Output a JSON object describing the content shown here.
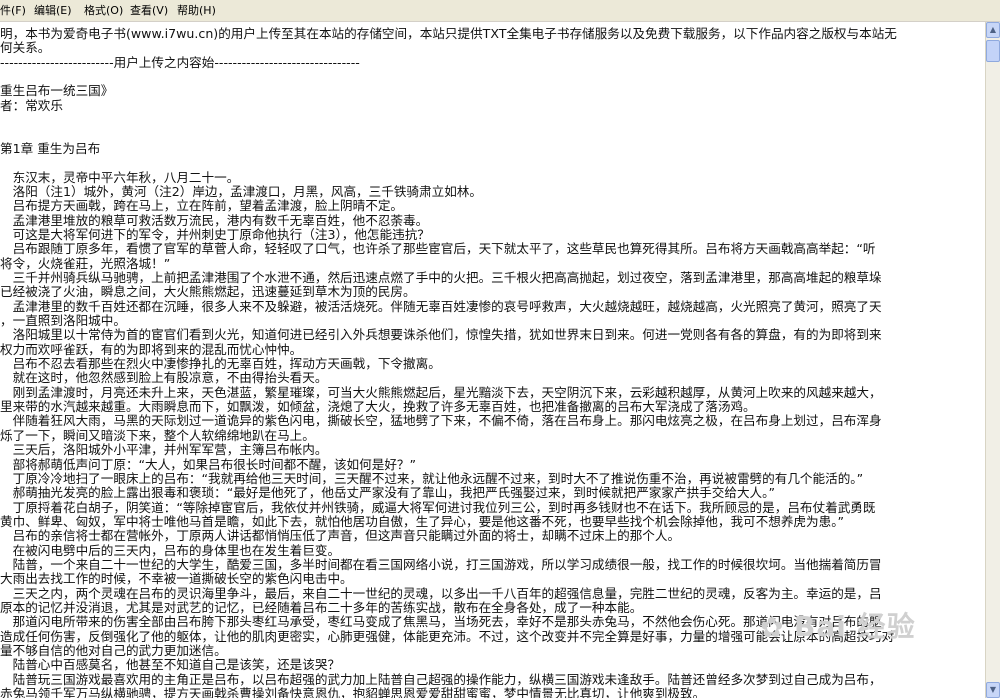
{
  "menu": [
    "件(F)",
    "编辑(E)",
    "格式(O)",
    "查看(V)",
    "帮助(H)"
  ],
  "lines": [
    "明，本书为爱奇电子书(www.i7wu.cn)的用户上传至其在本站的存储空间，本站只提供TXT全集电子书存储服务以及免费下载服务，以下作品内容之版权与本站无",
    "何关系。",
    "-------------------------用户上传之内容始--------------------------------",
    "",
    "重生吕布一统三国》",
    "者：常欢乐",
    "",
    "",
    "第1章 重生为吕布",
    "",
    "　东汉末，灵帝中平六年秋，八月二十一。",
    "　洛阳（注1）城外，黄河（注2）岸边，孟津渡口，月黑，风高，三千铁骑肃立如林。",
    "　吕布提方天画戟，跨在马上，立在阵前，望着孟津渡，脸上阴晴不定。",
    "　孟津港里堆放的粮草可救活数万流民，港内有数千无辜百姓，他不忍荼毒。",
    "　可这是大将军何进下的军令，并州刺史丁原命他执行（注3），他怎能违抗？",
    "　吕布跟随丁原多年，看惯了官军的草菅人命，轻轻叹了口气，也许杀了那些宦官后，天下就太平了，这些草民也算死得其所。吕布将方天画戟高高举起：“听",
    "将令，火烧雀莊，光照洛城！”",
    "　三千并州骑兵纵马驰骋，上前把孟津港围了个水泄不通，然后迅速点燃了手中的火把。三千根火把高高抛起，划过夜空，落到孟津港里，那高高堆起的粮草垛",
    "已经被浇了火油，瞬息之间，大火熊熊燃起，迅速蔓延到草木为顶的民房。",
    "　孟津港里的数千百姓还都在沉睡，很多人来不及躲避，被活活烧死。伴随无辜百姓凄惨的哀号呼救声，大火越烧越旺，越烧越高，火光照亮了黄河，照亮了天",
    "，一直照到洛阳城中。",
    "　洛阳城里以十常侍为首的宦官们看到火光，知道何进已经引入外兵想要诛杀他们，惊惶失措，犹如世界末日到来。何进一党则各有各的算盘，有的为即将到来",
    "权力而欢呼雀跃，有的为即将到来的混乱而忧心忡忡。",
    "　吕布不忍去看那些在烈火中凄惨挣扎的无辜百姓，挥动方天画戟，下令撤离。",
    "　就在这时，他忽然感到脸上有股凉意，不由得抬头看天。",
    "　刚到孟津渡时，月亮还未升上来，天色湛蓝，繁星璀璨，可当大火熊熊燃起后，星光黯淡下去，天空阴沉下来，云彩越积越厚，从黄河上吹来的风越来越大，",
    "里来带的水汽越来越重。大雨瞬息而下，如飘泼，如倾盆，浇熄了大火，挽救了许多无辜百姓，也把准备撤离的吕布大军浇成了落汤鸡。",
    "　伴随着狂风大雨，马黑的天际划过一道诡异的紫色闪电，撕破长空，猛地劈了下来，不偏不倚，落在吕布身上。那闪电炫亮之极，在吕布身上划过，吕布浑身",
    "烁了一下，瞬间又暗淡下来，整个人软绵绵地趴在马上。",
    "　三天后，洛阳城外小平津，并州军军营，主簿吕布帐内。",
    "　部将郝萌低声问丁原：“大人，如果吕布很长时间都不醒，该如何是好？”",
    "　丁原冷冷地扫了一眼床上的吕布：“我就再给他三天时间，三天醒不过来，就让他永远醒不过来，到时大不了推说伤重不治，再说被雷劈的有几个能活的。”",
    "　郝萌抽光发亮的脸上露出狠毒和褒琐：“最好是他死了，他岳丈严家没有了靠山，我把严氏强娶过来，到时候就把严家家产拱手交给大人。”",
    "　丁原捋着花白胡子，阴笑道：“等除掉宦官后，我依仗并州铁骑，威逼大将军何进讨我位列三公，到时再多钱财也不在话下。我所顾忌的是，吕布仗着武勇既",
    "黄巾、鲜卑、匈奴，军中将士唯他马首是瞻，如此下去，就怕他居功自傲，生了异心，要是他这番不死，也要早些找个机会除掉他，我可不想养虎为患。”",
    "　吕布的亲信将士都在营帐外，丁原两人讲话都悄悄压低了声音，但这声音只能瞒过外面的将士，却瞒不过床上的那个人。",
    "　在被闪电劈中后的三天内，吕布的身体里也在发生着巨变。",
    "　陆普，一个来自二十一世纪的大学生，酷爱三国，多半时间都在看三国网络小说，打三国游戏，所以学习成绩很一般，找工作的时候很坎坷。当他揣着简历冒",
    "大雨出去找工作的时候，不幸被一道撕破长空的紫色闪电击中。",
    "　三天之内，两个灵魂在吕布的灵识海里争斗，最后，来自二十一世纪的灵魂，以多出一千八百年的超强信息量，完胜二世纪的灵魂，反客为主。幸运的是，吕",
    "原本的记忆并没消退，尤其是对武艺的记忆，已经随着吕布二十多年的苦练实战，散布在全身各处，成了一种本能。",
    "　那道闪电所带来的伤害全部由吕布胯下那头枣红马承受，枣红马变成了焦黑马，当场死去，幸好不是那头赤兔马，不然他会伤心死。那道闪电没有对吕布的躯",
    "造成任何伤害，反倒强化了他的躯体，让他的肌肉更密实，心肺更强健，体能更充沛。不过，这个改变并不完全算是好事，力量的增强可能会让原本的高超技巧对",
    "量不够自信的他对自己的武力更加迷信。",
    "　陆普心中百感莫名，他甚至不知道自己是该笑，还是该哭？",
    "　陆普玩三国游戏最喜欢用的主角正是吕布，以吕布超强的武力加上陆普自己超强的操作能力，纵横三国游戏未逢敌手。陆普还曾经多次梦到过自己成为吕布，",
    "赤兔马领千军万马纵横驰骋，提方天画戟杀曹操刘备快意恩仇，抱貂蝉思恩爱爱甜甜蜜蜜，梦中情景无比真切，让他爽到极致。"
  ],
  "watermark": "Bai 经验",
  "watermark_icon": "paw-print-icon"
}
